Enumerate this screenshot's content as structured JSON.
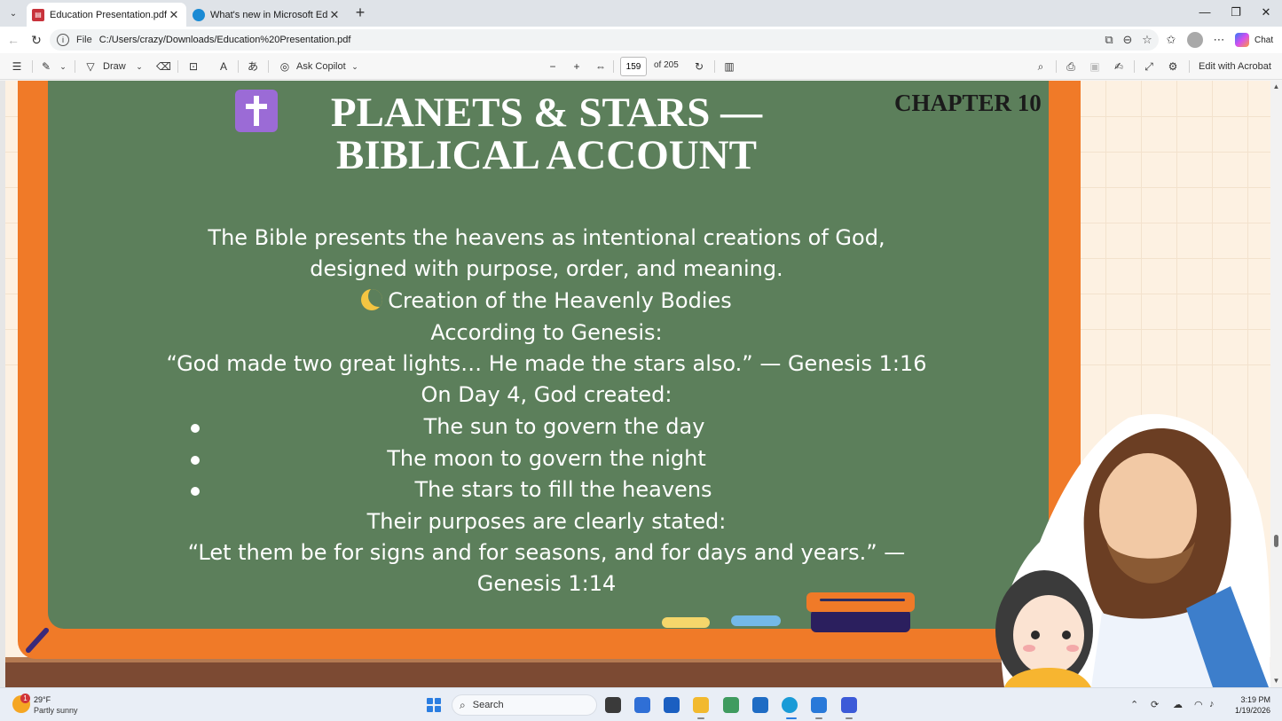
{
  "browser": {
    "tabs": [
      {
        "label": "Education Presentation.pdf",
        "icon": "pdf-icon",
        "active": true
      },
      {
        "label": "What's new in Microsoft Edge",
        "icon": "edge-icon",
        "active": false
      }
    ],
    "address": {
      "scheme_label": "File",
      "url": "C:/Users/crazy/Downloads/Education%20Presentation.pdf"
    },
    "chat_label": "Chat"
  },
  "pdf_toolbar": {
    "draw_label": "Draw",
    "copilot_label": "Ask Copilot",
    "page_number": "159",
    "page_count": "of 205",
    "edit_acrobat_label": "Edit with Acrobat"
  },
  "slide": {
    "title": "PLANETS & STARS — BIBLICAL ACCOUNT",
    "chapter": "CHAPTER 10",
    "lines": [
      "The Bible presents the heavens as intentional creations of God,",
      "designed with purpose, order, and meaning.",
      "Creation of the Heavenly Bodies",
      "According to Genesis:",
      "“God made two great lights… He made the stars also.” — Genesis 1:16",
      "On Day 4, God created:",
      "The sun to govern the day",
      "The moon to govern the night",
      "The stars to fill the heavens",
      "Their purposes are clearly stated:",
      "“Let them be for signs and for seasons, and for days and years.” —",
      "Genesis 1:14"
    ],
    "colors": {
      "board": "#5c7f5b",
      "frame": "#f07a28",
      "background": "#fdf1e2"
    }
  },
  "taskbar": {
    "weather_temp": "29°F",
    "weather_desc": "Partly sunny",
    "weather_badge": "1",
    "search_placeholder": "Search",
    "time": "3:19 PM",
    "date": "1/19/2026"
  }
}
